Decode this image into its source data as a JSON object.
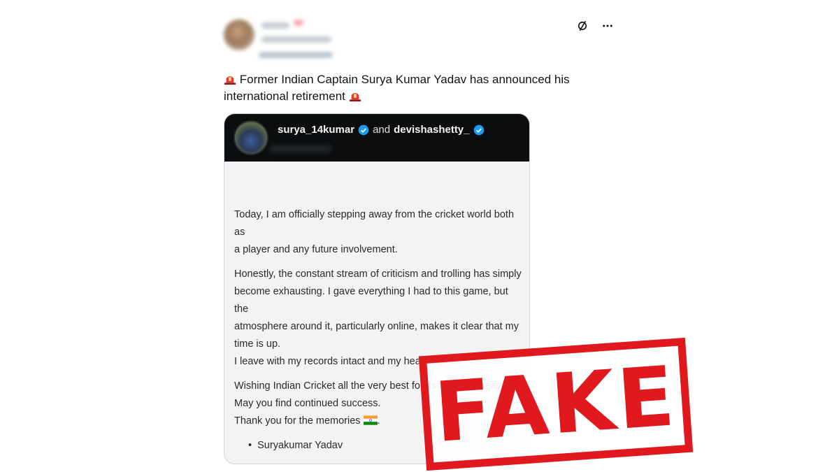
{
  "post": {
    "text_part1": "Former Indian Captain Surya Kumar Yadav has announced his international retirement",
    "icons": {
      "siren": "police-light-emoji",
      "mute": "mute-icon",
      "more": "more-icon"
    }
  },
  "card": {
    "user1": "surya_14kumar",
    "connector": "and",
    "user2": "devishashetty_",
    "paragraphs": [
      [
        "Today, I am officially stepping away from the cricket world both as",
        "a player and any future involvement."
      ],
      [
        "Honestly, the constant stream of criticism and trolling has simply",
        "become exhausting. I gave everything I had to this game, but the",
        "atmosphere around it, particularly online, makes it clear that my",
        "time is up.",
        "I leave with my records intact and my head high."
      ],
      [
        "Wishing Indian Cricket all the very best for its future endeavors.",
        "May you find continued success.",
        "Thank you for the memories"
      ]
    ],
    "signature": "Suryakumar Yadav",
    "period": "."
  },
  "stamp": {
    "text": "FAKE",
    "color": "#e0191e"
  },
  "colors": {
    "verified": "#1d9bf0",
    "card_header_bg": "#0b0d0f"
  }
}
